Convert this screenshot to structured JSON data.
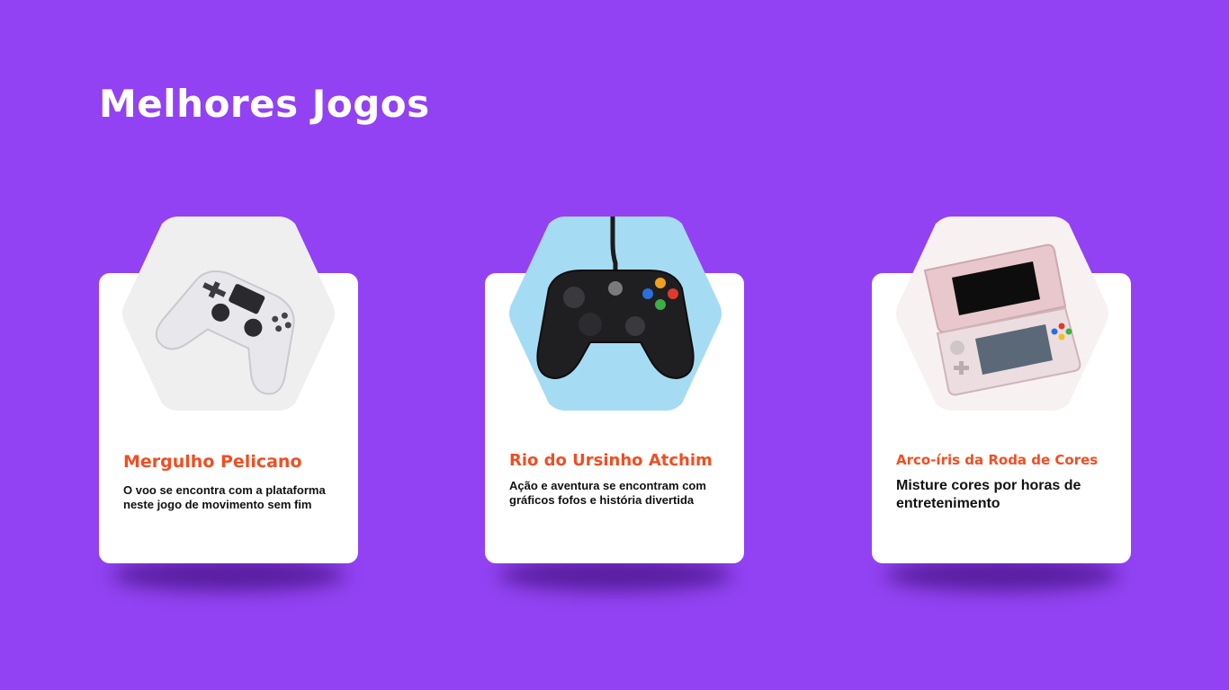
{
  "page": {
    "title": "Melhores Jogos"
  },
  "colors": {
    "background": "#9242f2",
    "card": "#ffffff",
    "accent": "#f04e23",
    "text": "#111111",
    "hex_1": "#efefef",
    "hex_2": "#a6dcf3",
    "hex_3": "#f7f1f2"
  },
  "games": [
    {
      "title": "Mergulho Pelicano",
      "description": "O voo se encontra com a plataforma\nneste jogo de movimento sem fim",
      "image_icon": "white-gamepad-icon"
    },
    {
      "title": "Rio do Ursinho Atchim",
      "description": "Ação e aventura se encontram com\ngráficos fofos e história divertida",
      "image_icon": "black-wired-controller-icon"
    },
    {
      "title": "Arco-íris da Roda de Cores",
      "description": "Misture cores por horas de\nentretenimento",
      "image_icon": "handheld-console-icon"
    }
  ]
}
